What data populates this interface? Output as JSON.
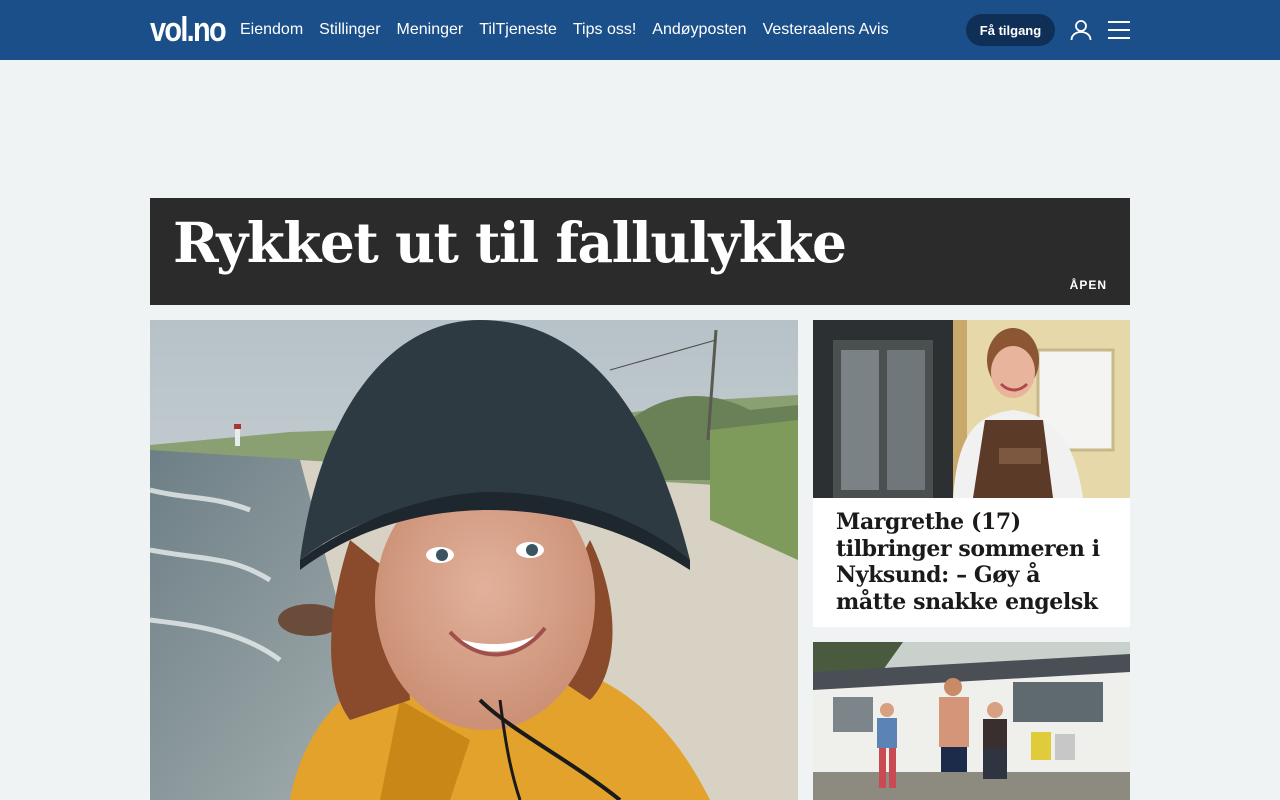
{
  "header": {
    "logo": "vol.no",
    "nav": [
      "Eiendom",
      "Stillinger",
      "Meninger",
      "TilTjeneste",
      "Tips oss!",
      "Andøyposten",
      "Vesteraalens Avis"
    ],
    "access_button": "Få tilgang",
    "user_icon": "user-icon",
    "menu_icon": "hamburger-menu-icon"
  },
  "banner": {
    "title": "Rykket ut til fallulykke",
    "tag": "ÅPEN"
  },
  "teasers": {
    "side1_title": "Margrethe (17) tilbringer sommeren i Nyksund: – Gøy å måtte snakke engelsk"
  },
  "colors": {
    "header_bg": "#1b4f8a",
    "access_button_bg": "#0f2f56",
    "banner_bg": "#2b2b2b",
    "page_bg": "#eff3f4"
  }
}
